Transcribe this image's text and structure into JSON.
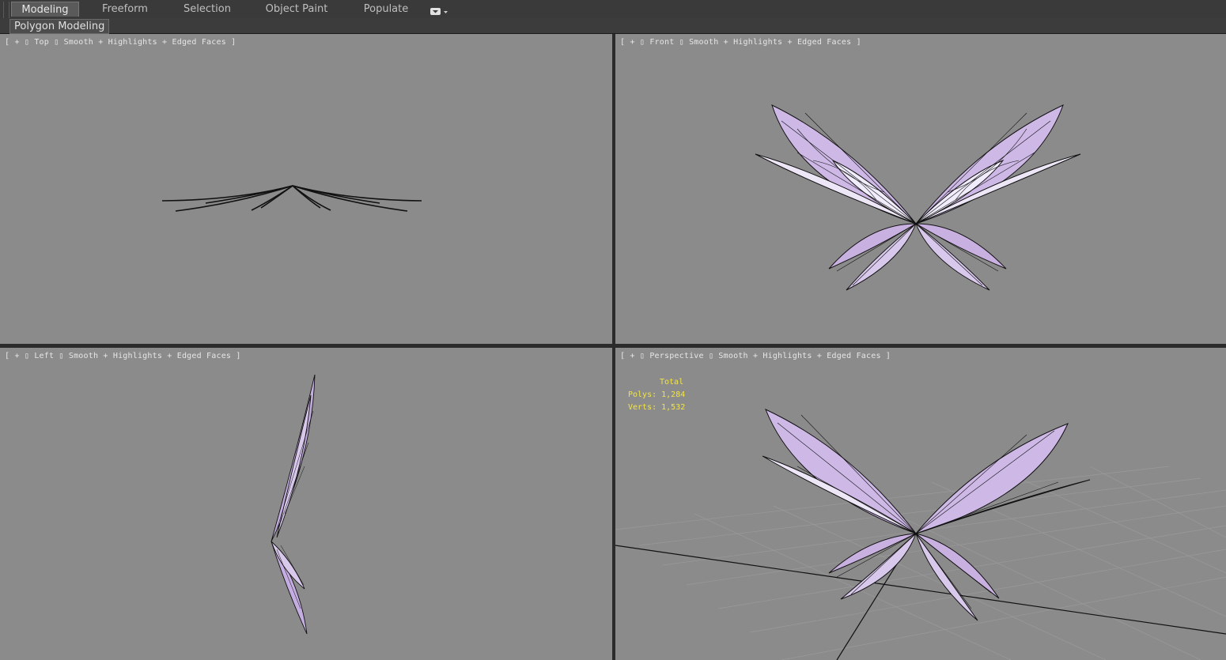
{
  "ribbon": {
    "tabs": [
      {
        "label": "Modeling",
        "active": true
      },
      {
        "label": "Freeform",
        "active": false
      },
      {
        "label": "Selection",
        "active": false
      },
      {
        "label": "Object Paint",
        "active": false
      },
      {
        "label": "Populate",
        "active": false
      }
    ],
    "options_icon": "dropdown-arrow-icon",
    "panel_label": "Polygon Modeling"
  },
  "viewports": {
    "top": {
      "label": "[ + ▯ Top ▯ Smooth + Highlights + Edged Faces ]"
    },
    "front": {
      "label": "[ + ▯ Front ▯ Smooth + Highlights + Edged Faces ]"
    },
    "left": {
      "label": "[ + ▯ Left ▯ Smooth + Highlights + Edged Faces ]"
    },
    "perspective": {
      "label": "[ + ▯ Perspective ▯ Smooth + Highlights + Edged Faces ]"
    }
  },
  "stats": {
    "title": "Total",
    "polys": "Polys: 1,284",
    "verts": "Verts: 1,532"
  },
  "colors": {
    "viewport_bg": "#8b8b8b",
    "wing_fill": "#cdb8e6",
    "wing_highlight": "#f1ecfb",
    "wire": "#111111",
    "stats_text": "#f2e44a"
  }
}
